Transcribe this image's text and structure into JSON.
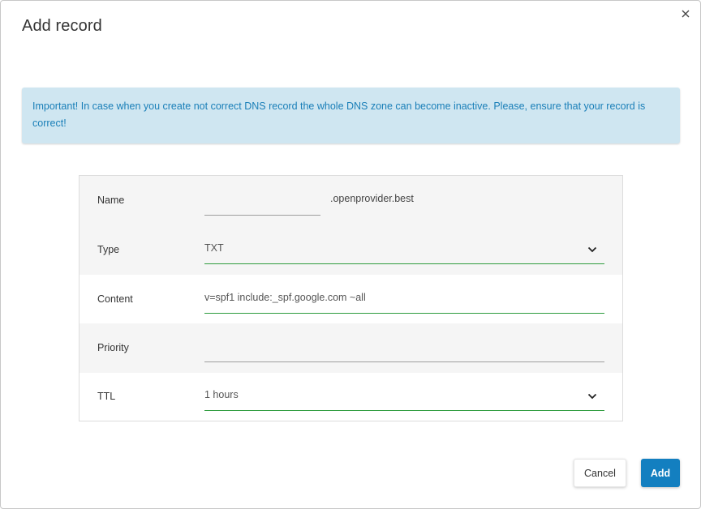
{
  "dialog": {
    "title": "Add record",
    "close_icon": "close-icon"
  },
  "alert": {
    "text": "Important! In case when you create not correct DNS record the whole DNS zone can become inactive. Please, ensure that your record is correct!"
  },
  "form": {
    "name": {
      "label": "Name",
      "value": "",
      "suffix": ".openprovider.best"
    },
    "type": {
      "label": "Type",
      "value": "TXT",
      "icon": "chevron-down-icon"
    },
    "content": {
      "label": "Content",
      "value": "v=spf1 include:_spf.google.com ~all"
    },
    "priority": {
      "label": "Priority",
      "value": ""
    },
    "ttl": {
      "label": "TTL",
      "value": "1 hours",
      "icon": "chevron-down-icon"
    }
  },
  "buttons": {
    "cancel_label": "Cancel",
    "add_label": "Add"
  },
  "colors": {
    "accent": "#137fc0",
    "alert_bg": "#cfe6f1",
    "alert_text": "#1a7fb8",
    "active_underline": "#2e9c3e"
  }
}
